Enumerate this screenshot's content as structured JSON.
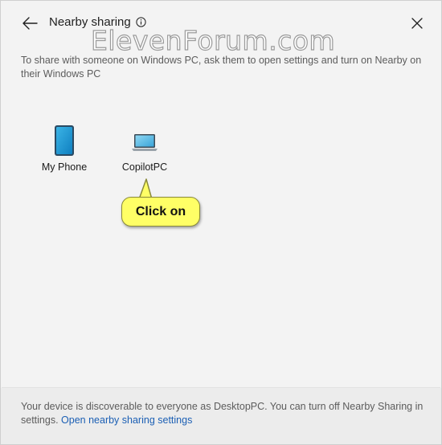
{
  "window": {
    "title": "Nearby sharing",
    "watermark": "ElevenForum.com"
  },
  "instructions": "To share with someone on Windows PC, ask them to open settings and turn on Nearby on their Windows PC",
  "devices": [
    {
      "label": "My Phone",
      "icon": "phone-icon"
    },
    {
      "label": "CopilotPC",
      "icon": "laptop-icon"
    }
  ],
  "callout": {
    "text": "Click on",
    "color": "#ffff66"
  },
  "footer": {
    "text": "Your device is discoverable to everyone as DesktopPC. You can turn off Nearby Sharing in settings. ",
    "link": "Open nearby sharing settings",
    "link_color": "#1b5fb4"
  }
}
